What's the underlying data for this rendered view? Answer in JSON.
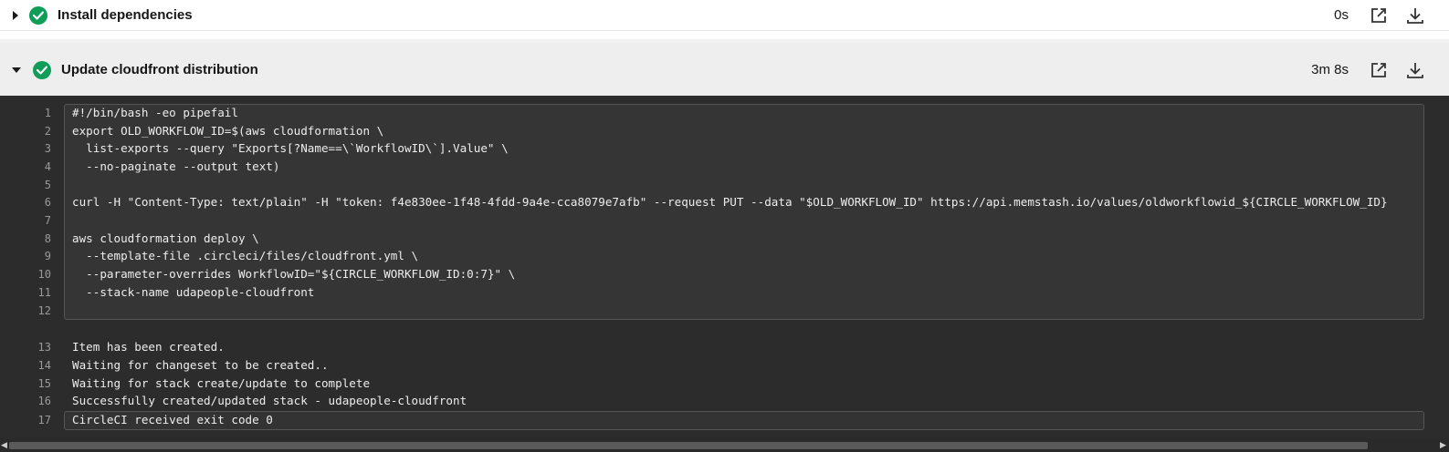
{
  "steps": [
    {
      "title": "Install dependencies",
      "duration": "0s",
      "expanded": false,
      "status": "success"
    },
    {
      "title": "Update cloudfront distribution",
      "duration": "3m 8s",
      "expanded": true,
      "status": "success"
    }
  ],
  "colors": {
    "success": "#0f9d58",
    "console_bg": "#2c2c2c"
  },
  "icons": {
    "status": "check-circle-icon",
    "open": "external-link-icon",
    "download": "download-icon"
  },
  "console": {
    "lines": [
      {
        "n": "1",
        "text": "#!/bin/bash -eo pipefail"
      },
      {
        "n": "2",
        "text": "export OLD_WORKFLOW_ID=$(aws cloudformation \\"
      },
      {
        "n": "3",
        "text": "  list-exports --query \"Exports[?Name==\\`WorkflowID\\`].Value\" \\"
      },
      {
        "n": "4",
        "text": "  --no-paginate --output text)"
      },
      {
        "n": "5",
        "text": ""
      },
      {
        "n": "6",
        "text": "curl -H \"Content-Type: text/plain\" -H \"token: f4e830ee-1f48-4fdd-9a4e-cca8079e7afb\" --request PUT --data \"$OLD_WORKFLOW_ID\" https://api.memstash.io/values/oldworkflowid_${CIRCLE_WORKFLOW_ID}"
      },
      {
        "n": "7",
        "text": ""
      },
      {
        "n": "8",
        "text": "aws cloudformation deploy \\"
      },
      {
        "n": "9",
        "text": "  --template-file .circleci/files/cloudfront.yml \\"
      },
      {
        "n": "10",
        "text": "  --parameter-overrides WorkflowID=\"${CIRCLE_WORKFLOW_ID:0:7}\" \\"
      },
      {
        "n": "11",
        "text": "  --stack-name udapeople-cloudfront"
      },
      {
        "n": "12",
        "text": ""
      },
      {
        "n": "13",
        "text": "Item has been created."
      },
      {
        "n": "14",
        "text": "Waiting for changeset to be created.."
      },
      {
        "n": "15",
        "text": "Waiting for stack create/update to complete"
      },
      {
        "n": "16",
        "text": "Successfully created/updated stack - udapeople-cloudfront"
      },
      {
        "n": "17",
        "text": "CircleCI received exit code 0"
      }
    ]
  }
}
